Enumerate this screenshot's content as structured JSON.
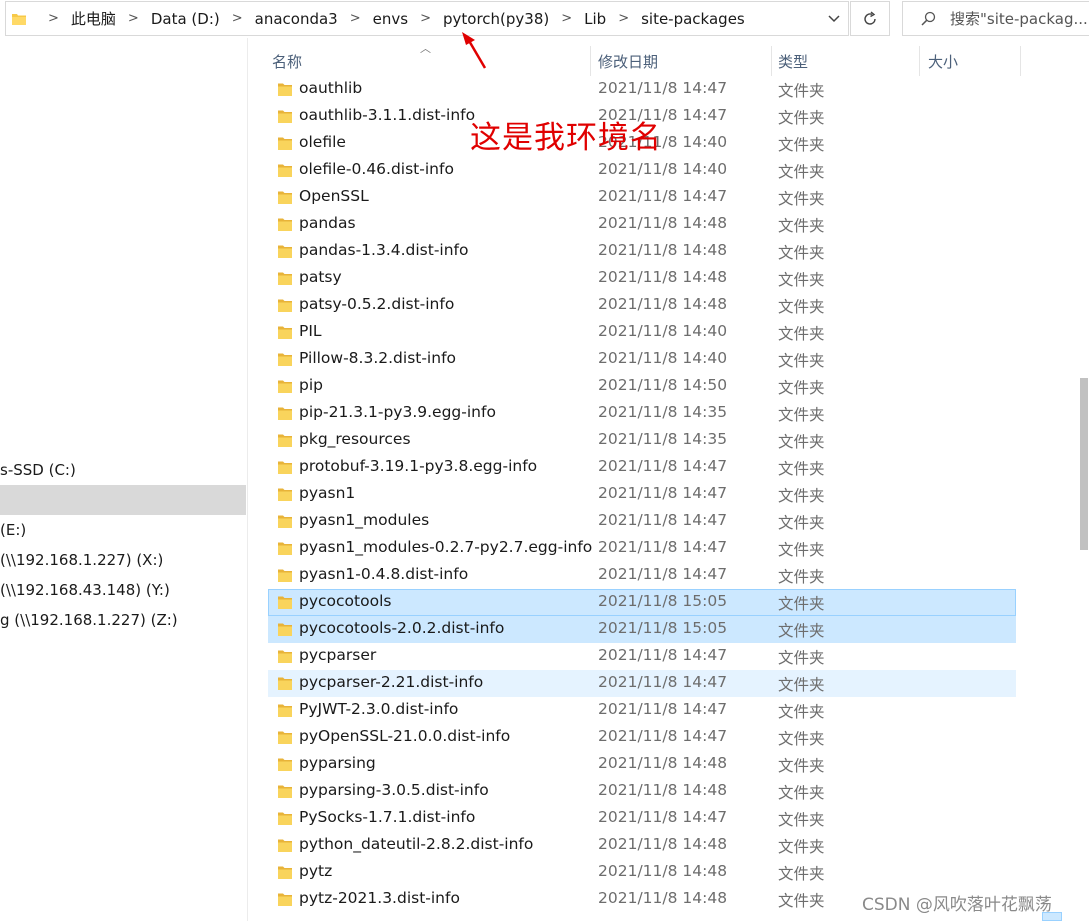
{
  "address_bar": {
    "crumbs": [
      "此电脑",
      "Data (D:)",
      "anaconda3",
      "envs",
      "pytorch(py38)",
      "Lib",
      "site-packages"
    ],
    "separator": ">",
    "dropdown_icon": "chevron-down-icon",
    "refresh_icon": "refresh-icon"
  },
  "search": {
    "placeholder": "搜索\"site-packag..."
  },
  "nav_pane": {
    "items": [
      "s-SSD (C:)",
      "",
      "(E:)",
      "(\\\\192.168.1.227) (X:)",
      "(\\\\192.168.43.148) (Y:)",
      "g (\\\\192.168.1.227) (Z:)"
    ],
    "selected_index": 1
  },
  "columns": {
    "name": "名称",
    "date": "修改日期",
    "type": "类型",
    "size": "大小"
  },
  "rows": [
    {
      "name": "oauthlib",
      "date": "2021/11/8 14:47",
      "type": "文件夹",
      "state": ""
    },
    {
      "name": "oauthlib-3.1.1.dist-info",
      "date": "2021/11/8 14:47",
      "type": "文件夹",
      "state": ""
    },
    {
      "name": "olefile",
      "date": "2021/11/8 14:40",
      "type": "文件夹",
      "state": ""
    },
    {
      "name": "olefile-0.46.dist-info",
      "date": "2021/11/8 14:40",
      "type": "文件夹",
      "state": ""
    },
    {
      "name": "OpenSSL",
      "date": "2021/11/8 14:47",
      "type": "文件夹",
      "state": ""
    },
    {
      "name": "pandas",
      "date": "2021/11/8 14:48",
      "type": "文件夹",
      "state": ""
    },
    {
      "name": "pandas-1.3.4.dist-info",
      "date": "2021/11/8 14:48",
      "type": "文件夹",
      "state": ""
    },
    {
      "name": "patsy",
      "date": "2021/11/8 14:48",
      "type": "文件夹",
      "state": ""
    },
    {
      "name": "patsy-0.5.2.dist-info",
      "date": "2021/11/8 14:48",
      "type": "文件夹",
      "state": ""
    },
    {
      "name": "PIL",
      "date": "2021/11/8 14:40",
      "type": "文件夹",
      "state": ""
    },
    {
      "name": "Pillow-8.3.2.dist-info",
      "date": "2021/11/8 14:40",
      "type": "文件夹",
      "state": ""
    },
    {
      "name": "pip",
      "date": "2021/11/8 14:50",
      "type": "文件夹",
      "state": ""
    },
    {
      "name": "pip-21.3.1-py3.9.egg-info",
      "date": "2021/11/8 14:35",
      "type": "文件夹",
      "state": ""
    },
    {
      "name": "pkg_resources",
      "date": "2021/11/8 14:35",
      "type": "文件夹",
      "state": ""
    },
    {
      "name": "protobuf-3.19.1-py3.8.egg-info",
      "date": "2021/11/8 14:47",
      "type": "文件夹",
      "state": ""
    },
    {
      "name": "pyasn1",
      "date": "2021/11/8 14:47",
      "type": "文件夹",
      "state": ""
    },
    {
      "name": "pyasn1_modules",
      "date": "2021/11/8 14:47",
      "type": "文件夹",
      "state": ""
    },
    {
      "name": "pyasn1_modules-0.2.7-py2.7.egg-info",
      "date": "2021/11/8 14:47",
      "type": "文件夹",
      "state": ""
    },
    {
      "name": "pyasn1-0.4.8.dist-info",
      "date": "2021/11/8 14:47",
      "type": "文件夹",
      "state": ""
    },
    {
      "name": "pycocotools",
      "date": "2021/11/8 15:05",
      "type": "文件夹",
      "state": "selected"
    },
    {
      "name": "pycocotools-2.0.2.dist-info",
      "date": "2021/11/8 15:05",
      "type": "文件夹",
      "state": "selected2"
    },
    {
      "name": "pycparser",
      "date": "2021/11/8 14:47",
      "type": "文件夹",
      "state": ""
    },
    {
      "name": "pycparser-2.21.dist-info",
      "date": "2021/11/8 14:47",
      "type": "文件夹",
      "state": "hover"
    },
    {
      "name": "PyJWT-2.3.0.dist-info",
      "date": "2021/11/8 14:47",
      "type": "文件夹",
      "state": ""
    },
    {
      "name": "pyOpenSSL-21.0.0.dist-info",
      "date": "2021/11/8 14:47",
      "type": "文件夹",
      "state": ""
    },
    {
      "name": "pyparsing",
      "date": "2021/11/8 14:48",
      "type": "文件夹",
      "state": ""
    },
    {
      "name": "pyparsing-3.0.5.dist-info",
      "date": "2021/11/8 14:48",
      "type": "文件夹",
      "state": ""
    },
    {
      "name": "PySocks-1.7.1.dist-info",
      "date": "2021/11/8 14:47",
      "type": "文件夹",
      "state": ""
    },
    {
      "name": "python_dateutil-2.8.2.dist-info",
      "date": "2021/11/8 14:48",
      "type": "文件夹",
      "state": ""
    },
    {
      "name": "pytz",
      "date": "2021/11/8 14:48",
      "type": "文件夹",
      "state": ""
    },
    {
      "name": "pytz-2021.3.dist-info",
      "date": "2021/11/8 14:48",
      "type": "文件夹",
      "state": ""
    }
  ],
  "annotation": {
    "text": "这是我环境名",
    "color": "#e00000"
  },
  "watermark": "CSDN @风吹落叶花飘荡",
  "colors": {
    "folder": "#f7c948",
    "selection": "#cce8ff",
    "hover": "#e5f3ff",
    "header_text": "#4c607a"
  }
}
